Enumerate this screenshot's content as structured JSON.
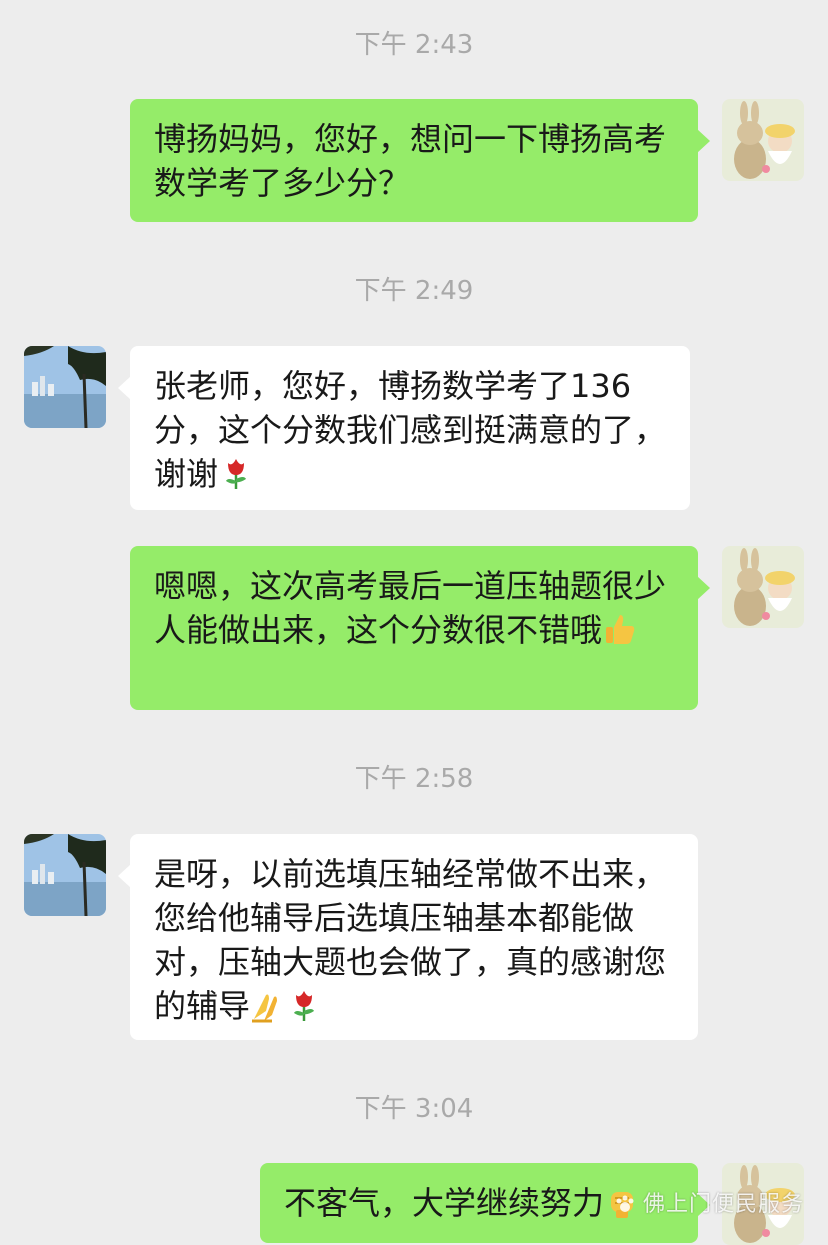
{
  "messages": [
    {
      "timestamp": "下午 2:43",
      "side": "me",
      "text": "博扬妈妈，您好，想问一下博扬高考数学考了多少分？",
      "emoji": []
    },
    {
      "timestamp": "下午 2:49",
      "side": "them",
      "text": "张老师，您好，博扬数学考了136分，这个分数我们感到挺满意的了，谢谢",
      "emoji": [
        "rose-emoji"
      ]
    },
    {
      "timestamp": "",
      "side": "me",
      "text": "嗯嗯，这次高考最后一道压轴题很少人能做出来，这个分数很不错哦",
      "emoji": [
        "thumbs-up-emoji"
      ]
    },
    {
      "timestamp": "下午 2:58",
      "side": "them",
      "text": "是呀，以前选填压轴经常做不出来，您给他辅导后选填压轴基本都能做对，压轴大题也会做了，真的感谢您的辅导",
      "emoji": [
        "praying-hands-emoji",
        "rose-emoji"
      ]
    },
    {
      "timestamp": "下午 3:04",
      "side": "me",
      "text": "不客气，大学继续努力",
      "emoji": [
        "fist-emoji"
      ]
    }
  ],
  "watermark": "佛上门便民服务",
  "colors": {
    "background": "#ededed",
    "my_bubble": "#95ec69",
    "their_bubble": "#ffffff",
    "timestamp": "#a9a9a9"
  }
}
